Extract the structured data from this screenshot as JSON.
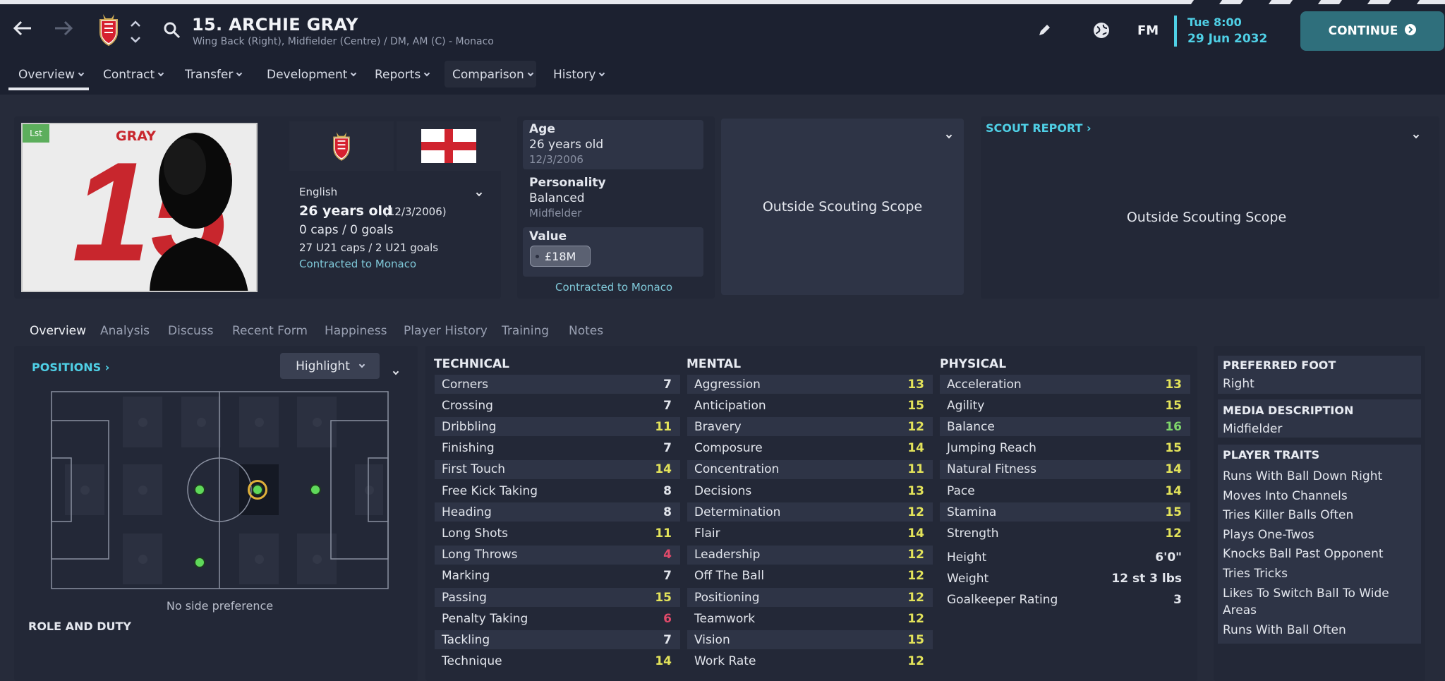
{
  "header": {
    "title": "15. ARCHIE GRAY",
    "subtitle": "Wing Back (Right), Midfielder (Centre) / DM, AM (C) - Monaco",
    "fm_label": "FM",
    "time": "Tue 8:00",
    "date": "29 Jun 2032",
    "continue_label": "CONTINUE"
  },
  "menu": [
    "Overview",
    "Contract",
    "Transfer",
    "Development",
    "Reports",
    "Comparison",
    "History"
  ],
  "profile": {
    "kit_name": "GRAY",
    "kit_number": "15",
    "list_badge": "Lst",
    "nationality": "English",
    "age_line": "26 years old",
    "dob_paren": "(12/3/2006)",
    "caps": "0 caps / 0 goals",
    "u21": "27 U21 caps / 2 U21 goals",
    "contract": "Contracted to Monaco"
  },
  "info": {
    "age_label": "Age",
    "age_value": "26 years old",
    "age_dob": "12/3/2006",
    "personality_label": "Personality",
    "personality_value": "Balanced",
    "personality_sub": "Midfielder",
    "value_label": "Value",
    "value_amount": "£18M",
    "contract": "Contracted to Monaco"
  },
  "scouting": {
    "outside1": "Outside Scouting Scope",
    "scout_report": "SCOUT REPORT",
    "outside2": "Outside Scouting Scope"
  },
  "subtabs": [
    "Overview",
    "Analysis",
    "Discuss",
    "Recent Form",
    "Happiness",
    "Player History",
    "Training",
    "Notes"
  ],
  "positions": {
    "title": "POSITIONS",
    "highlight": "Highlight",
    "side_pref": "No side preference",
    "role_duty": "ROLE AND DUTY"
  },
  "attributes": {
    "technical_title": "TECHNICAL",
    "mental_title": "MENTAL",
    "physical_title": "PHYSICAL",
    "technical": [
      {
        "name": "Corners",
        "value": "7"
      },
      {
        "name": "Crossing",
        "value": "7"
      },
      {
        "name": "Dribbling",
        "value": "11"
      },
      {
        "name": "Finishing",
        "value": "7"
      },
      {
        "name": "First Touch",
        "value": "14"
      },
      {
        "name": "Free Kick Taking",
        "value": "8"
      },
      {
        "name": "Heading",
        "value": "8"
      },
      {
        "name": "Long Shots",
        "value": "11"
      },
      {
        "name": "Long Throws",
        "value": "4"
      },
      {
        "name": "Marking",
        "value": "7"
      },
      {
        "name": "Passing",
        "value": "15"
      },
      {
        "name": "Penalty Taking",
        "value": "6"
      },
      {
        "name": "Tackling",
        "value": "7"
      },
      {
        "name": "Technique",
        "value": "14"
      }
    ],
    "mental": [
      {
        "name": "Aggression",
        "value": "13"
      },
      {
        "name": "Anticipation",
        "value": "15"
      },
      {
        "name": "Bravery",
        "value": "12"
      },
      {
        "name": "Composure",
        "value": "14"
      },
      {
        "name": "Concentration",
        "value": "11"
      },
      {
        "name": "Decisions",
        "value": "13"
      },
      {
        "name": "Determination",
        "value": "12"
      },
      {
        "name": "Flair",
        "value": "14"
      },
      {
        "name": "Leadership",
        "value": "12"
      },
      {
        "name": "Off The Ball",
        "value": "12"
      },
      {
        "name": "Positioning",
        "value": "12"
      },
      {
        "name": "Teamwork",
        "value": "12"
      },
      {
        "name": "Vision",
        "value": "15"
      },
      {
        "name": "Work Rate",
        "value": "12"
      }
    ],
    "physical": [
      {
        "name": "Acceleration",
        "value": "13"
      },
      {
        "name": "Agility",
        "value": "15"
      },
      {
        "name": "Balance",
        "value": "16"
      },
      {
        "name": "Jumping Reach",
        "value": "15"
      },
      {
        "name": "Natural Fitness",
        "value": "14"
      },
      {
        "name": "Pace",
        "value": "14"
      },
      {
        "name": "Stamina",
        "value": "15"
      },
      {
        "name": "Strength",
        "value": "12"
      }
    ],
    "extra": [
      {
        "name": "Height",
        "value": "6'0\""
      },
      {
        "name": "Weight",
        "value": "12 st 3 lbs"
      },
      {
        "name": "Goalkeeper Rating",
        "value": "3"
      }
    ]
  },
  "right": {
    "foot_label": "PREFERRED FOOT",
    "foot_value": "Right",
    "media_label": "MEDIA DESCRIPTION",
    "media_value": "Midfielder",
    "traits_label": "PLAYER TRAITS",
    "traits": [
      "Runs With Ball Down Right",
      "Moves Into Channels",
      "Tries Killer Balls Often",
      "Plays One-Twos",
      "Knocks Ball Past Opponent",
      "Tries Tricks",
      "Likes To Switch Ball To Wide Areas",
      "Runs With Ball Often"
    ]
  },
  "colors": {
    "white": "#e2e5ec",
    "yellow": "#e3e35a",
    "green": "#7ed56a",
    "red": "#e04a6a",
    "cyan": "#4fd0e6"
  }
}
